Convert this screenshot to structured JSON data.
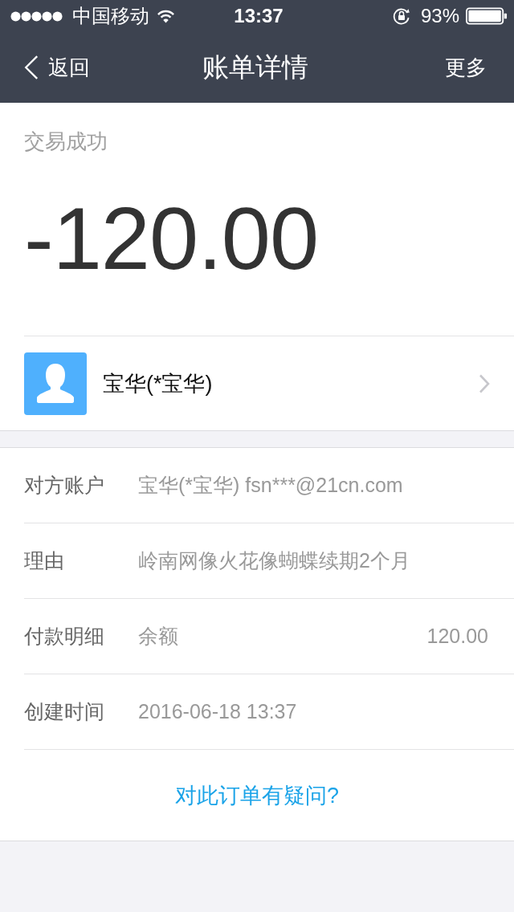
{
  "status_bar": {
    "carrier": "中国移动",
    "time": "13:37",
    "battery": "93%"
  },
  "nav": {
    "back": "返回",
    "title": "账单详情",
    "more": "更多"
  },
  "summary": {
    "status": "交易成功",
    "amount": "-120.00"
  },
  "counterparty": {
    "name": "宝华(*宝华)"
  },
  "details": [
    {
      "label": "对方账户",
      "value": "宝华(*宝华) fsn***@21cn.com"
    },
    {
      "label": "理由",
      "value": "岭南网像火花像蝴蝶续期2个月"
    },
    {
      "label": "付款明细",
      "value": "余额",
      "amount": "120.00"
    },
    {
      "label": "创建时间",
      "value": "2016-06-18 13:37"
    }
  ],
  "help_link": "对此订单有疑问?"
}
